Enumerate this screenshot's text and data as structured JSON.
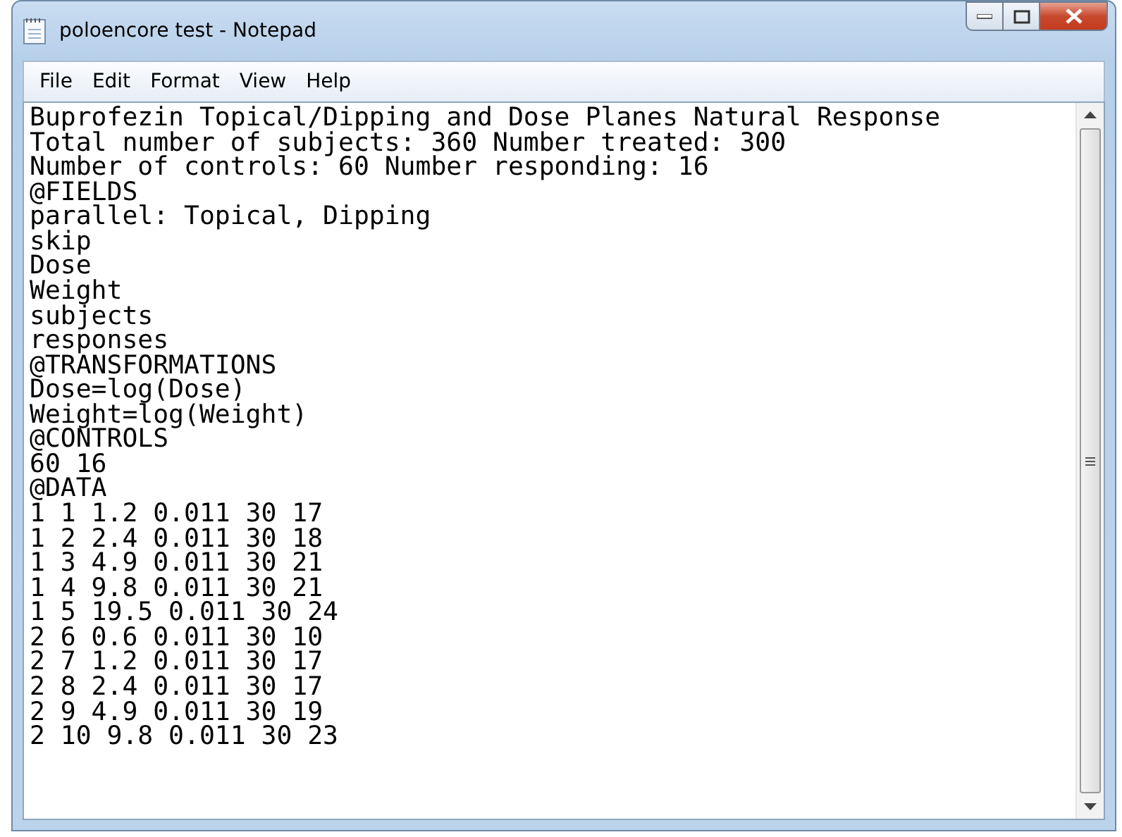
{
  "window": {
    "title": "poloencore test - Notepad"
  },
  "menu": [
    "File",
    "Edit",
    "Format",
    "View",
    "Help"
  ],
  "lines": [
    "Buprofezin Topical/Dipping and Dose Planes Natural Response",
    "Total number of subjects: 360 Number treated: 300",
    "Number of controls: 60 Number responding: 16",
    "@FIELDS",
    "parallel: Topical, Dipping",
    "skip",
    "Dose",
    "Weight",
    "subjects",
    "responses",
    "@TRANSFORMATIONS",
    "Dose=log(Dose)",
    "Weight=log(Weight)",
    "@CONTROLS",
    "60 16",
    "@DATA",
    "1 1 1.2 0.011 30 17",
    "1 2 2.4 0.011 30 18",
    "1 3 4.9 0.011 30 21",
    "1 4 9.8 0.011 30 21",
    "1 5 19.5 0.011 30 24",
    "2 6 0.6 0.011 30 10",
    "2 7 1.2 0.011 30 17",
    "2 8 2.4 0.011 30 17",
    "2 9 4.9 0.011 30 19",
    "2 10 9.8 0.011 30 23"
  ]
}
